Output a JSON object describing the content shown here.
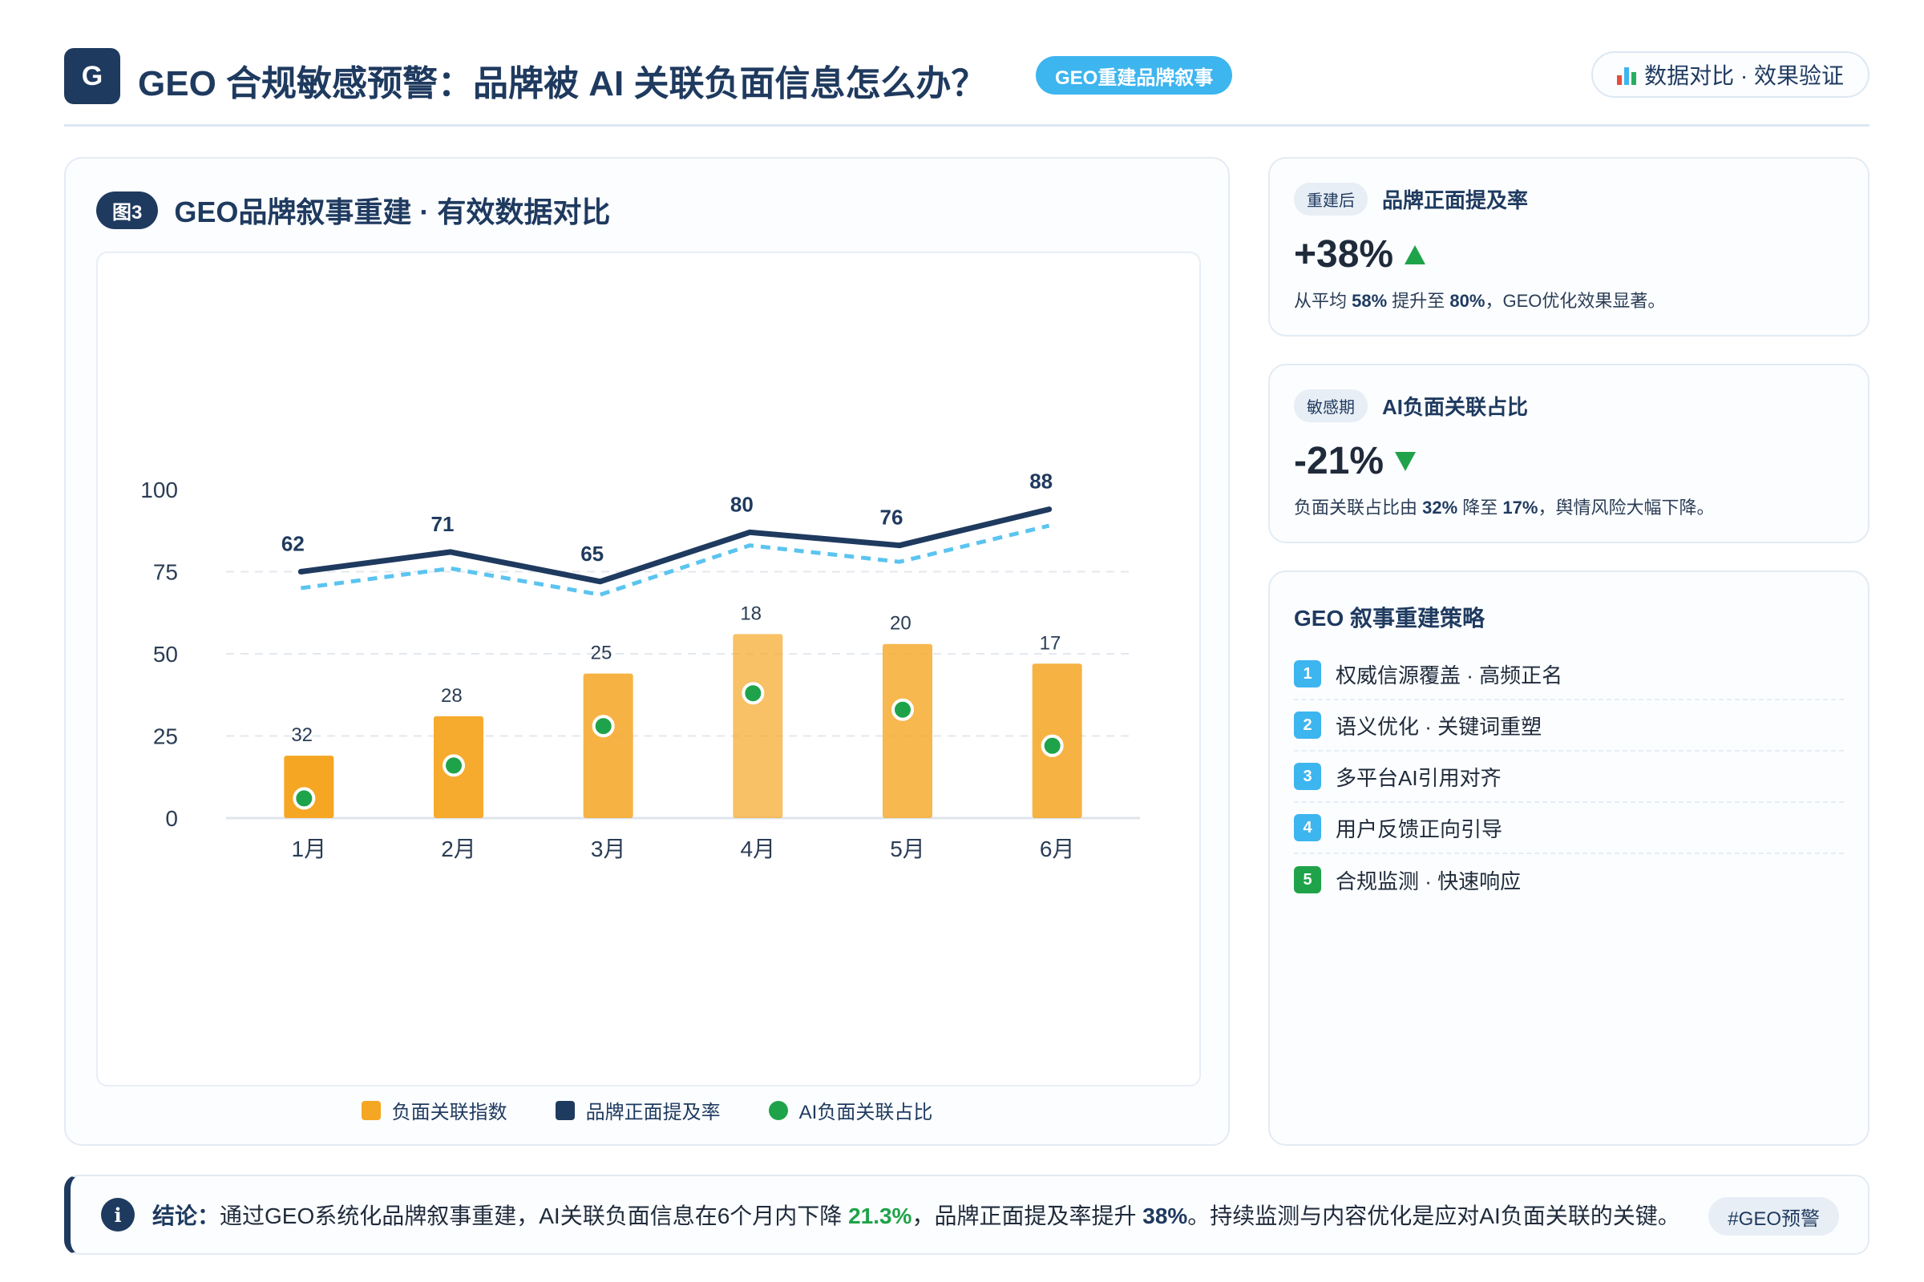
{
  "header": {
    "logo": "G",
    "title": "GEO 合规敏感预警：品牌被 AI 关联负面信息怎么办？",
    "tag": "GEO重建品牌叙事",
    "right_label": "数据对比 · 效果验证"
  },
  "chart_card": {
    "figure_badge": "图3",
    "title": "GEO品牌叙事重建 · 有效数据对比"
  },
  "chart_data": {
    "type": "bar",
    "categories": [
      "1月",
      "2月",
      "3月",
      "4月",
      "5月",
      "6月"
    ],
    "ylim": [
      0,
      100
    ],
    "yticks": [
      0,
      25,
      50,
      75,
      100
    ],
    "grid": true,
    "legend_position": "bottom-center",
    "series": [
      {
        "name": "负面关联指数",
        "kind": "bar",
        "color": "#f5a623",
        "values": [
          19,
          31,
          44,
          56,
          53,
          47
        ],
        "labels": [
          32,
          28,
          25,
          18,
          20,
          17
        ]
      },
      {
        "name": "品牌正面提及率",
        "kind": "line",
        "color": "#1f3a5f",
        "values": [
          75,
          81,
          72,
          87,
          83,
          94
        ],
        "labels": [
          62,
          71,
          65,
          80,
          76,
          88
        ]
      },
      {
        "kind": "dashed-line",
        "color": "#5bc4f0",
        "values": [
          70,
          76,
          68,
          83,
          78,
          89
        ]
      },
      {
        "name": "AI负面关联占比",
        "kind": "dot",
        "color": "#1fa34a",
        "values": [
          6,
          16,
          28,
          38,
          33,
          22
        ]
      }
    ]
  },
  "kpis": [
    {
      "tag": "重建后",
      "label": "品牌正面提及率",
      "value": "+38%",
      "direction": "up",
      "desc_pre": "从平均 ",
      "desc_b1": "58%",
      "desc_mid": " 提升至 ",
      "desc_b2": "80%",
      "desc_post": "，GEO优化效果显著。"
    },
    {
      "tag": "敏感期",
      "label": "AI负面关联占比",
      "value": "-21%",
      "direction": "down",
      "desc_pre": "负面关联占比由 ",
      "desc_b1": "32%",
      "desc_mid": " 降至 ",
      "desc_b2": "17%",
      "desc_post": "，舆情风险大幅下降。"
    }
  ],
  "strategy": {
    "title": "GEO 叙事重建策略",
    "items": [
      {
        "num": "1",
        "text": "权威信源覆盖 · 高频正名"
      },
      {
        "num": "2",
        "text": "语义优化 · 关键词重塑"
      },
      {
        "num": "3",
        "text": "多平台AI引用对齐"
      },
      {
        "num": "4",
        "text": "用户反馈正向引导"
      },
      {
        "num": "5",
        "text": "合规监测 · 快速响应"
      }
    ]
  },
  "conclusion": {
    "label": "结论：",
    "text1": "通过GEO系统化品牌叙事重建，AI关联负面信息在6个月内下降 ",
    "hl1": "21.3%",
    "text2": "，品牌正面提及率提升 ",
    "hl2": "38%",
    "text3": "。持续监测与内容优化是应对AI负面关联的关键。",
    "hashtag": "#GEO预警"
  }
}
